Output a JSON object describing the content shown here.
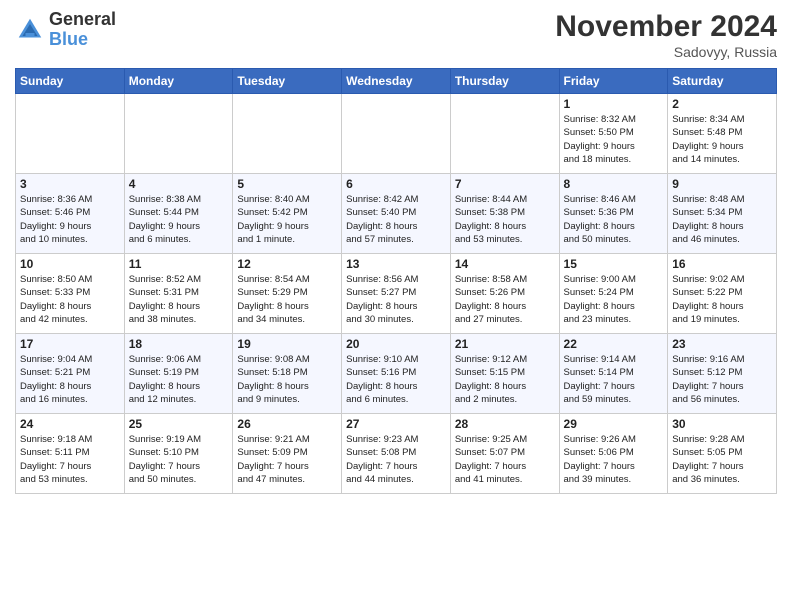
{
  "logo": {
    "text_general": "General",
    "text_blue": "Blue"
  },
  "header": {
    "month": "November 2024",
    "location": "Sadovyy, Russia"
  },
  "days_of_week": [
    "Sunday",
    "Monday",
    "Tuesday",
    "Wednesday",
    "Thursday",
    "Friday",
    "Saturday"
  ],
  "weeks": [
    [
      {
        "day": "",
        "info": ""
      },
      {
        "day": "",
        "info": ""
      },
      {
        "day": "",
        "info": ""
      },
      {
        "day": "",
        "info": ""
      },
      {
        "day": "",
        "info": ""
      },
      {
        "day": "1",
        "info": "Sunrise: 8:32 AM\nSunset: 5:50 PM\nDaylight: 9 hours\nand 18 minutes."
      },
      {
        "day": "2",
        "info": "Sunrise: 8:34 AM\nSunset: 5:48 PM\nDaylight: 9 hours\nand 14 minutes."
      }
    ],
    [
      {
        "day": "3",
        "info": "Sunrise: 8:36 AM\nSunset: 5:46 PM\nDaylight: 9 hours\nand 10 minutes."
      },
      {
        "day": "4",
        "info": "Sunrise: 8:38 AM\nSunset: 5:44 PM\nDaylight: 9 hours\nand 6 minutes."
      },
      {
        "day": "5",
        "info": "Sunrise: 8:40 AM\nSunset: 5:42 PM\nDaylight: 9 hours\nand 1 minute."
      },
      {
        "day": "6",
        "info": "Sunrise: 8:42 AM\nSunset: 5:40 PM\nDaylight: 8 hours\nand 57 minutes."
      },
      {
        "day": "7",
        "info": "Sunrise: 8:44 AM\nSunset: 5:38 PM\nDaylight: 8 hours\nand 53 minutes."
      },
      {
        "day": "8",
        "info": "Sunrise: 8:46 AM\nSunset: 5:36 PM\nDaylight: 8 hours\nand 50 minutes."
      },
      {
        "day": "9",
        "info": "Sunrise: 8:48 AM\nSunset: 5:34 PM\nDaylight: 8 hours\nand 46 minutes."
      }
    ],
    [
      {
        "day": "10",
        "info": "Sunrise: 8:50 AM\nSunset: 5:33 PM\nDaylight: 8 hours\nand 42 minutes."
      },
      {
        "day": "11",
        "info": "Sunrise: 8:52 AM\nSunset: 5:31 PM\nDaylight: 8 hours\nand 38 minutes."
      },
      {
        "day": "12",
        "info": "Sunrise: 8:54 AM\nSunset: 5:29 PM\nDaylight: 8 hours\nand 34 minutes."
      },
      {
        "day": "13",
        "info": "Sunrise: 8:56 AM\nSunset: 5:27 PM\nDaylight: 8 hours\nand 30 minutes."
      },
      {
        "day": "14",
        "info": "Sunrise: 8:58 AM\nSunset: 5:26 PM\nDaylight: 8 hours\nand 27 minutes."
      },
      {
        "day": "15",
        "info": "Sunrise: 9:00 AM\nSunset: 5:24 PM\nDaylight: 8 hours\nand 23 minutes."
      },
      {
        "day": "16",
        "info": "Sunrise: 9:02 AM\nSunset: 5:22 PM\nDaylight: 8 hours\nand 19 minutes."
      }
    ],
    [
      {
        "day": "17",
        "info": "Sunrise: 9:04 AM\nSunset: 5:21 PM\nDaylight: 8 hours\nand 16 minutes."
      },
      {
        "day": "18",
        "info": "Sunrise: 9:06 AM\nSunset: 5:19 PM\nDaylight: 8 hours\nand 12 minutes."
      },
      {
        "day": "19",
        "info": "Sunrise: 9:08 AM\nSunset: 5:18 PM\nDaylight: 8 hours\nand 9 minutes."
      },
      {
        "day": "20",
        "info": "Sunrise: 9:10 AM\nSunset: 5:16 PM\nDaylight: 8 hours\nand 6 minutes."
      },
      {
        "day": "21",
        "info": "Sunrise: 9:12 AM\nSunset: 5:15 PM\nDaylight: 8 hours\nand 2 minutes."
      },
      {
        "day": "22",
        "info": "Sunrise: 9:14 AM\nSunset: 5:14 PM\nDaylight: 7 hours\nand 59 minutes."
      },
      {
        "day": "23",
        "info": "Sunrise: 9:16 AM\nSunset: 5:12 PM\nDaylight: 7 hours\nand 56 minutes."
      }
    ],
    [
      {
        "day": "24",
        "info": "Sunrise: 9:18 AM\nSunset: 5:11 PM\nDaylight: 7 hours\nand 53 minutes."
      },
      {
        "day": "25",
        "info": "Sunrise: 9:19 AM\nSunset: 5:10 PM\nDaylight: 7 hours\nand 50 minutes."
      },
      {
        "day": "26",
        "info": "Sunrise: 9:21 AM\nSunset: 5:09 PM\nDaylight: 7 hours\nand 47 minutes."
      },
      {
        "day": "27",
        "info": "Sunrise: 9:23 AM\nSunset: 5:08 PM\nDaylight: 7 hours\nand 44 minutes."
      },
      {
        "day": "28",
        "info": "Sunrise: 9:25 AM\nSunset: 5:07 PM\nDaylight: 7 hours\nand 41 minutes."
      },
      {
        "day": "29",
        "info": "Sunrise: 9:26 AM\nSunset: 5:06 PM\nDaylight: 7 hours\nand 39 minutes."
      },
      {
        "day": "30",
        "info": "Sunrise: 9:28 AM\nSunset: 5:05 PM\nDaylight: 7 hours\nand 36 minutes."
      }
    ]
  ]
}
